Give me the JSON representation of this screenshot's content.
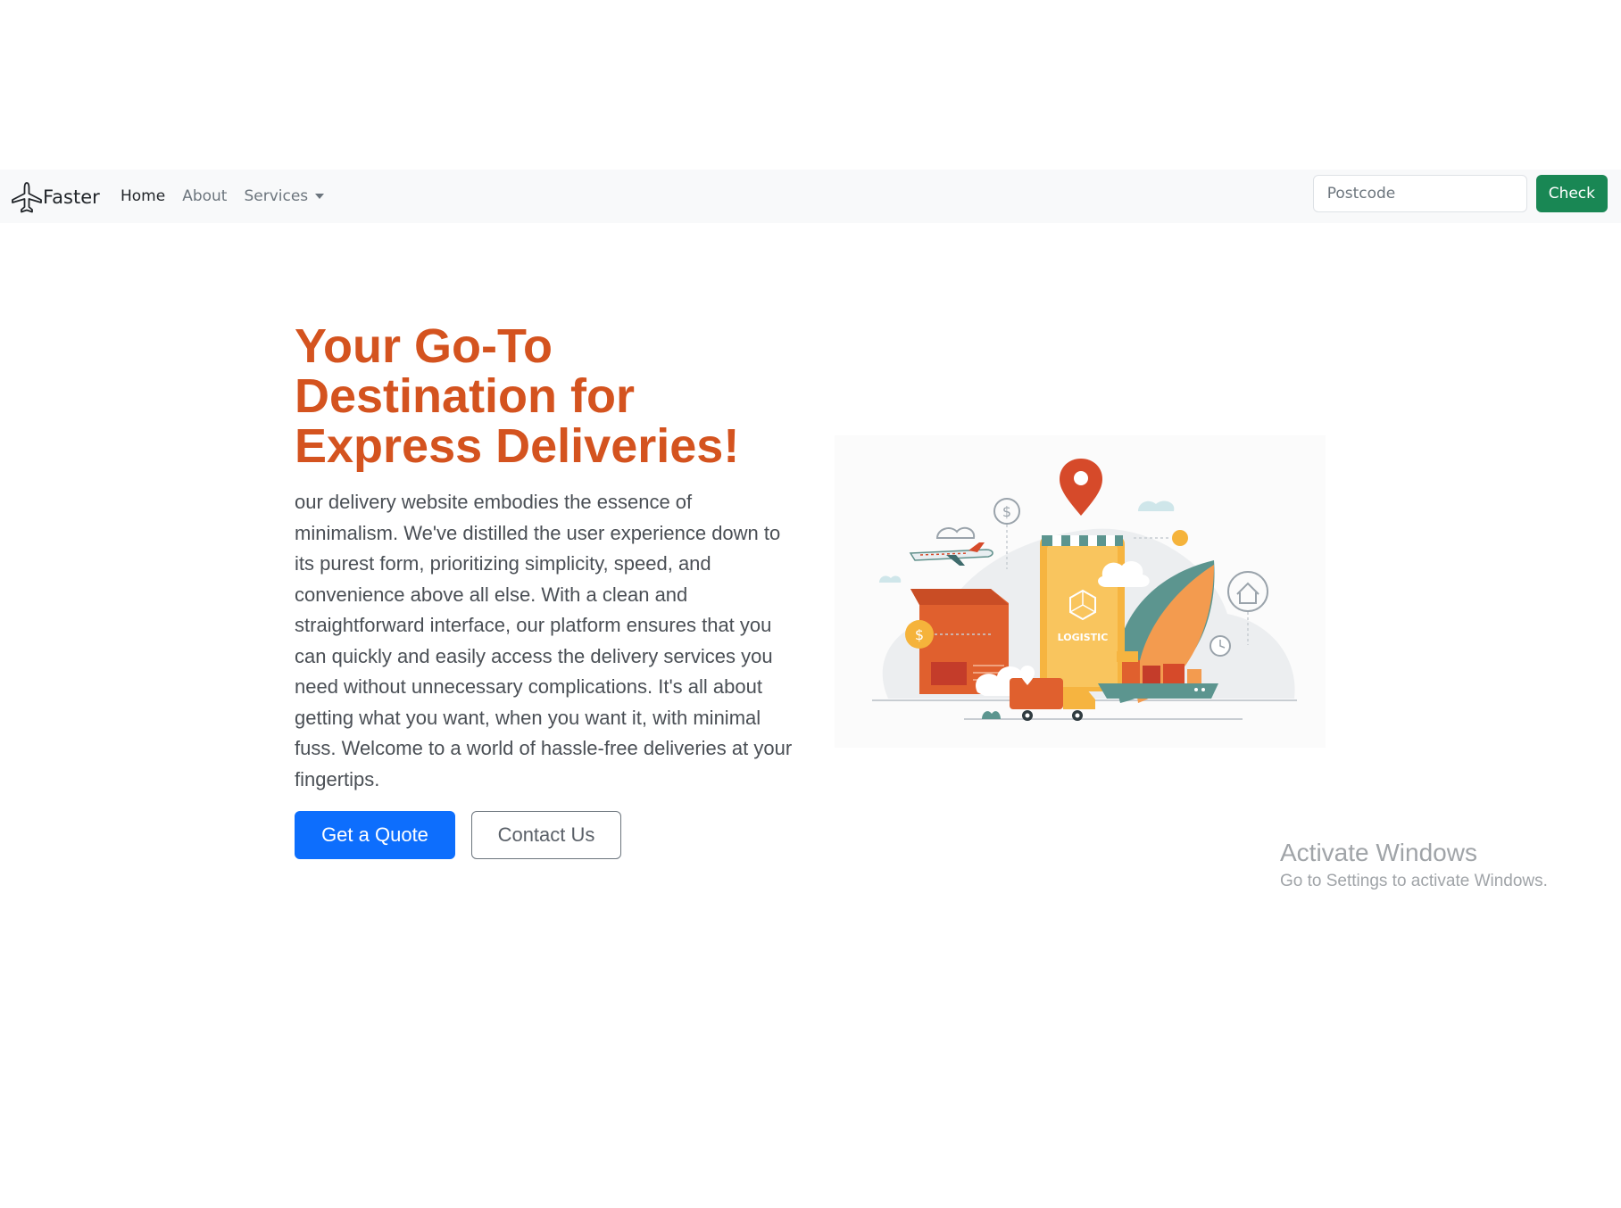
{
  "navbar": {
    "brand": "Faster",
    "links": [
      {
        "label": "Home"
      },
      {
        "label": "About"
      },
      {
        "label": "Services"
      }
    ],
    "search_placeholder": "Postcode",
    "check_label": "Check"
  },
  "hero": {
    "title": "Your Go-To Destination for Express Deliveries!",
    "text": "our delivery website embodies the essence of minimalism. We've distilled the user experience down to its purest form, prioritizing simplicity, speed, and convenience above all else. With a clean and straightforward interface, our platform ensures that you can quickly and easily access the delivery services you need without unnecessary complications. It's all about getting what you want, when you want it, with minimal fuss. Welcome to a world of hassle-free deliveries at your fingertips.",
    "primary_button": "Get a Quote",
    "secondary_button": "Contact Us",
    "illustration_label": "LOGISTIC"
  },
  "watermark": {
    "title": "Activate Windows",
    "subtitle": "Go to Settings to activate Windows."
  },
  "colors": {
    "accent_title": "#d4531f",
    "primary": "#0d6efd",
    "success": "#198754",
    "navbar_bg": "#f8f9fa"
  }
}
